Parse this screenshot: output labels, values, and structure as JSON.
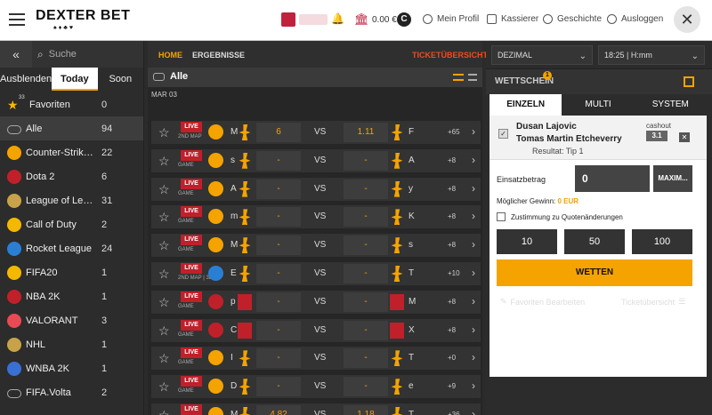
{
  "header": {
    "logo_main": "DEXTER BET",
    "logo_sub": "♠♦♣♥",
    "balance": "0.00 €",
    "profile_label": "Mein Profil",
    "cashier_label": "Kassierer",
    "history_label": "Geschichte",
    "logout_label": "Ausloggen",
    "close_glyph": "✕"
  },
  "sidebar": {
    "collapse_glyph": "«",
    "search_placeholder": "Suche",
    "tabs": [
      "Ausblenden",
      "Today",
      "Soon"
    ],
    "favorites_badge": "33",
    "items": [
      {
        "label": "Favoriten",
        "count": "0",
        "icon": "star-icon",
        "color": "#f5b800"
      },
      {
        "label": "Alle",
        "count": "94",
        "icon": "gamepad-icon",
        "color": "#aaaaaa"
      },
      {
        "label": "Counter-Strike: ...",
        "count": "22",
        "icon": "counter-strike-icon",
        "color": "#f5a300"
      },
      {
        "label": "Dota 2",
        "count": "6",
        "icon": "dota-icon",
        "color": "#c0202a"
      },
      {
        "label": "League of Lege...",
        "count": "31",
        "icon": "lol-icon",
        "color": "#c8a24a"
      },
      {
        "label": "Call of Duty",
        "count": "2",
        "icon": "cod-icon",
        "color": "#f5b800"
      },
      {
        "label": "Rocket League",
        "count": "24",
        "icon": "rocket-league-icon",
        "color": "#2a7fd4"
      },
      {
        "label": "FIFA20",
        "count": "1",
        "icon": "fifa-icon",
        "color": "#f5b800"
      },
      {
        "label": "NBA 2K",
        "count": "1",
        "icon": "nba-icon",
        "color": "#c0202a"
      },
      {
        "label": "VALORANT",
        "count": "3",
        "icon": "valorant-icon",
        "color": "#e84b55"
      },
      {
        "label": "NHL",
        "count": "1",
        "icon": "nhl-icon",
        "color": "#c8a24a"
      },
      {
        "label": "WNBA 2K",
        "count": "1",
        "icon": "wnba-icon",
        "color": "#3a6fd4"
      },
      {
        "label": "FIFA.Volta",
        "count": "2",
        "icon": "gamepad-icon",
        "color": "#aaaaaa"
      }
    ]
  },
  "center": {
    "tab_home": "HOME",
    "tab_results": "ERGEBNISSE",
    "tab_ticket": "TICKETÜBERSICHT",
    "section_title": "Alle",
    "date": "MAR 03",
    "vs_label": "VS",
    "live_label": "LIVE",
    "matches": [
      {
        "sub": "2ND MAP",
        "game": "cs",
        "t1": "M",
        "odd1": "6",
        "odd2": "1.11",
        "t2": "F",
        "more": "+65"
      },
      {
        "sub": "GAME",
        "game": "cs",
        "t1": "s",
        "odd1": "-",
        "odd2": "-",
        "t2": "A",
        "more": "+8"
      },
      {
        "sub": "GAME",
        "game": "cs",
        "t1": "A",
        "odd1": "-",
        "odd2": "-",
        "t2": "y",
        "more": "+8"
      },
      {
        "sub": "GAME",
        "game": "cs",
        "t1": "m",
        "odd1": "-",
        "odd2": "-",
        "t2": "K",
        "more": "+8"
      },
      {
        "sub": "GAME",
        "game": "cs",
        "t1": "M",
        "odd1": "-",
        "odd2": "-",
        "t2": "s",
        "more": "+8"
      },
      {
        "sub": "2ND MAP | 38'",
        "game": "rl",
        "t1": "E",
        "odd1": "-",
        "odd2": "-",
        "t2": "T",
        "more": "+10"
      },
      {
        "sub": "GAME",
        "game": "dota",
        "t1": "p",
        "odd1": "-",
        "odd2": "-",
        "t2": "M",
        "more": "+8"
      },
      {
        "sub": "GAME",
        "game": "dota",
        "t1": "C",
        "odd1": "-",
        "odd2": "-",
        "t2": "X",
        "more": "+8"
      },
      {
        "sub": "GAME",
        "game": "cs",
        "t1": "I",
        "odd1": "-",
        "odd2": "-",
        "t2": "T",
        "more": "+0"
      },
      {
        "sub": "GAME",
        "game": "cs",
        "t1": "D",
        "odd1": "-",
        "odd2": "-",
        "t2": "e",
        "more": "+9"
      },
      {
        "sub": "3RD MAP",
        "game": "cs",
        "t1": "M",
        "odd1": "4.82",
        "odd2": "1.18",
        "t2": "T",
        "more": "+36"
      }
    ]
  },
  "right": {
    "odds_format": "DEZIMAL",
    "time_format": "18:25 | H:mm",
    "slip_title": "WETTSCHEIN",
    "slip_badge": "1",
    "tabs": [
      "EINZELN",
      "MULTI",
      "SYSTEM"
    ],
    "bet": {
      "team1": "Dusan Lajovic",
      "team2": "Tomas Martin Etcheverry",
      "result": "Resultat: Tip 1",
      "cashout": "cashout",
      "odd": "3.1",
      "remove": "✕",
      "checkbox": "✓"
    },
    "stake_label": "Einsatzbetrag",
    "stake_value": "0",
    "max_label": "MAXIM...",
    "win_label": "Möglicher Gewinn:",
    "win_value": "0 EUR",
    "agree_label": "Zustimmung zu Quotenänderungen",
    "quick": [
      "10",
      "50",
      "100"
    ],
    "place_bet": "WETTEN",
    "edit_favorites": "Favoriten Bearbeiten",
    "ticket_overview": "Ticketübersicht"
  }
}
